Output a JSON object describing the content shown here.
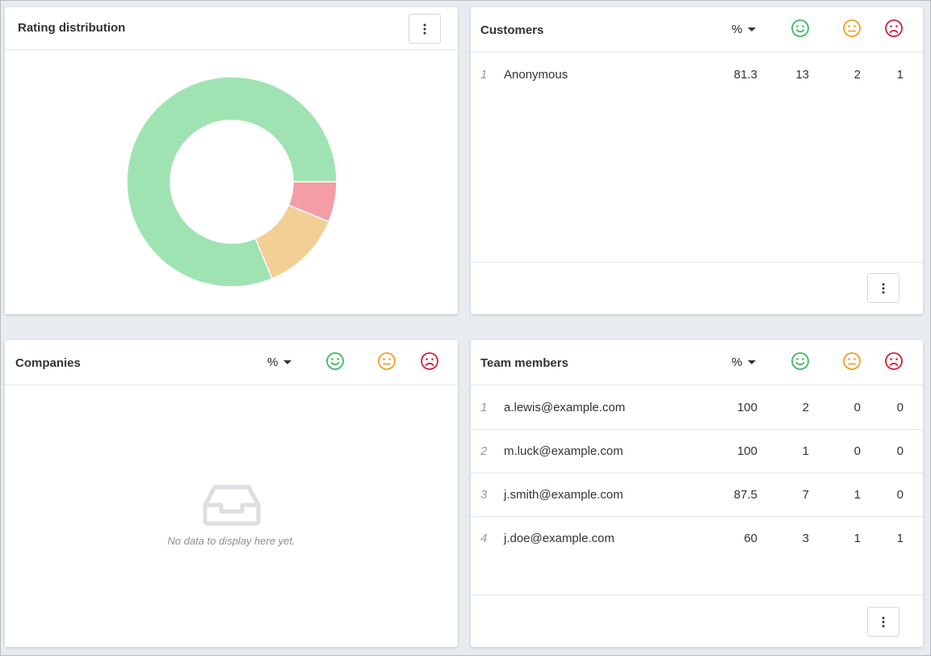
{
  "rating_distribution": {
    "title": "Rating distribution",
    "menu_icon": "vertical-dots-icon",
    "colors": {
      "positive": "#a0e3b2",
      "neutral": "#f2cf94",
      "negative": "#f49da6"
    },
    "chart_data": {
      "type": "pie",
      "donut": true,
      "slices": [
        {
          "label": "Positive",
          "value": 81.3,
          "color": "#a0e3b2"
        },
        {
          "label": "Neutral",
          "value": 12.5,
          "color": "#f2cf94"
        },
        {
          "label": "Negative",
          "value": 6.2,
          "color": "#f49da6"
        }
      ]
    }
  },
  "customers": {
    "title": "Customers",
    "sort_label": "%",
    "face_icons": [
      "smile-icon",
      "neutral-face-icon",
      "frown-icon"
    ],
    "rows": [
      {
        "index": "1",
        "name": "Anonymous",
        "percent": "81.3",
        "positive": "13",
        "neutral": "2",
        "negative": "1"
      }
    ]
  },
  "companies": {
    "title": "Companies",
    "sort_label": "%",
    "empty_icon": "inbox-tray-icon",
    "empty_text": "No data to display here yet."
  },
  "team_members": {
    "title": "Team members",
    "sort_label": "%",
    "rows": [
      {
        "index": "1",
        "name": "a.lewis@example.com",
        "percent": "100",
        "positive": "2",
        "neutral": "0",
        "negative": "0"
      },
      {
        "index": "2",
        "name": "m.luck@example.com",
        "percent": "100",
        "positive": "1",
        "neutral": "0",
        "negative": "0"
      },
      {
        "index": "3",
        "name": "j.smith@example.com",
        "percent": "87.5",
        "positive": "7",
        "neutral": "1",
        "negative": "0"
      },
      {
        "index": "4",
        "name": "j.doe@example.com",
        "percent": "60",
        "positive": "3",
        "neutral": "1",
        "negative": "1"
      }
    ]
  },
  "face_colors": {
    "positive": "#3dbb61",
    "neutral": "#f0a020",
    "negative": "#d0243a"
  }
}
